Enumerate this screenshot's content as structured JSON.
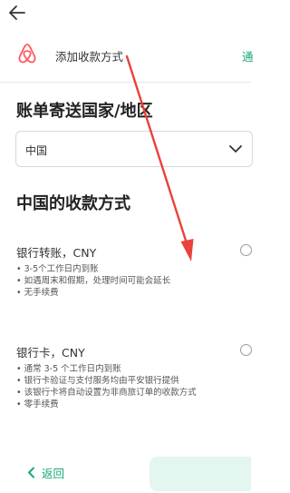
{
  "header": {
    "title": "添加收款方式",
    "next_partial": "通"
  },
  "country_section": {
    "title": "账单寄送国家/地区",
    "selected_country": "中国"
  },
  "methods_section": {
    "title": "中国的收款方式",
    "options": [
      {
        "title": "银行转账，CNY",
        "bullets": [
          "• 3-5个工作日内到账",
          "• 如遇周末和假期，处理时间可能会延长",
          "• 无手续费"
        ],
        "selected": false
      },
      {
        "title": "银行卡，CNY",
        "bullets": [
          "• 通常 3-5 个工作日内到账",
          "• 银行卡验证与支付服务均由平安银行提供",
          "• 该银行卡将自动设置为非商旅订单的收款方式",
          "• 零手续费"
        ],
        "selected": false
      }
    ]
  },
  "footer": {
    "back_label": "返回"
  },
  "colors": {
    "accent": "#19a974",
    "brand": "#ff5a5f",
    "annotation_arrow": "#e8423a"
  },
  "icons": {
    "top_back": "arrow-left-icon",
    "logo": "airbnb-logo-icon",
    "dropdown": "chevron-down-icon",
    "footer_back": "chevron-left-icon"
  }
}
